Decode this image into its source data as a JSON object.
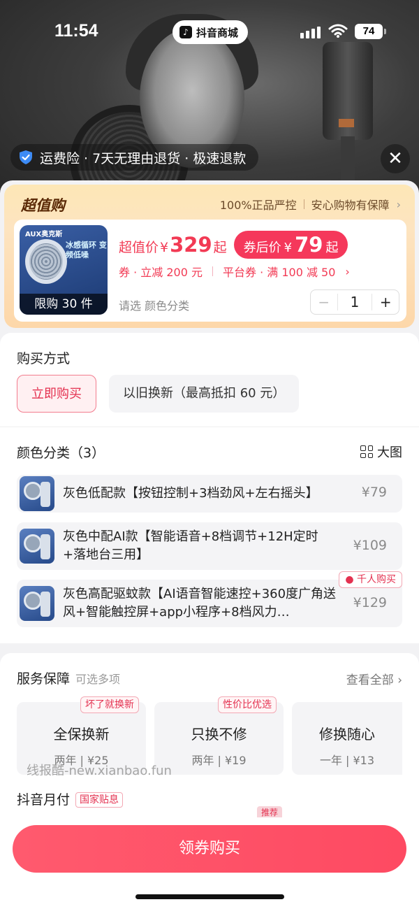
{
  "status": {
    "time": "11:54",
    "app_pill": "抖音商城",
    "battery": "74"
  },
  "assurance": {
    "text": "运费险 · 7天无理由退货 · 极速退款"
  },
  "deal": {
    "title": "超值购",
    "tag1": "100%正品严控",
    "tag2": "安心购物有保障",
    "image_brand": "AUX奥克斯",
    "image_headline": "冰感循环 变频低噪",
    "limit_label": "限购 30 件",
    "price_label": "超值价",
    "price_currency": "¥",
    "price_value": "329",
    "price_suffix": "起",
    "after_label": "券后价",
    "after_currency": "¥",
    "after_value": "79",
    "after_suffix": "起",
    "coupon1": "券 · 立减 200 元",
    "coupon2": "平台券 · 满 100 减 50",
    "select_hint": "请选 颜色分类",
    "qty": "1"
  },
  "purchase": {
    "title": "购买方式",
    "option_buy": "立即购买",
    "option_tradein": "以旧换新（最高抵扣 60 元）"
  },
  "colors": {
    "title": "颜色分类（3）",
    "big_image": "大图",
    "items": [
      {
        "name": "灰色低配款【按钮控制+3档劲风+左右摇头】",
        "price": "¥79"
      },
      {
        "name": "灰色中配AI款【智能语音+8档调节+12H定时+落地台三用】",
        "price": "¥109"
      },
      {
        "name": "灰色高配驱蚊款【AI语音智能速控+360度广角送风+智能触控屏+app小程序+8档风力…",
        "price": "¥129",
        "badge": "千人购买"
      }
    ]
  },
  "service": {
    "title": "服务保障",
    "subtitle": "可选多项",
    "see_all": "查看全部",
    "items": [
      {
        "title": "全保换新",
        "detail": "两年 | ¥25",
        "badge": "坏了就换新"
      },
      {
        "title": "只换不修",
        "detail": "两年 | ¥19",
        "badge": "性价比优选"
      },
      {
        "title": "修换随心",
        "detail": "一年 | ¥13",
        "badge": ""
      }
    ]
  },
  "watermark": "线报酷-new.xianbao.fun",
  "pay": {
    "title": "抖音月付",
    "badge": "国家贴息",
    "recommend": "推荐"
  },
  "cta": {
    "label": "领券购买"
  },
  "colors_theme": {
    "accent": "#f23a54",
    "cta": "#fe4a62",
    "deal_bg": "#fde4c0"
  }
}
